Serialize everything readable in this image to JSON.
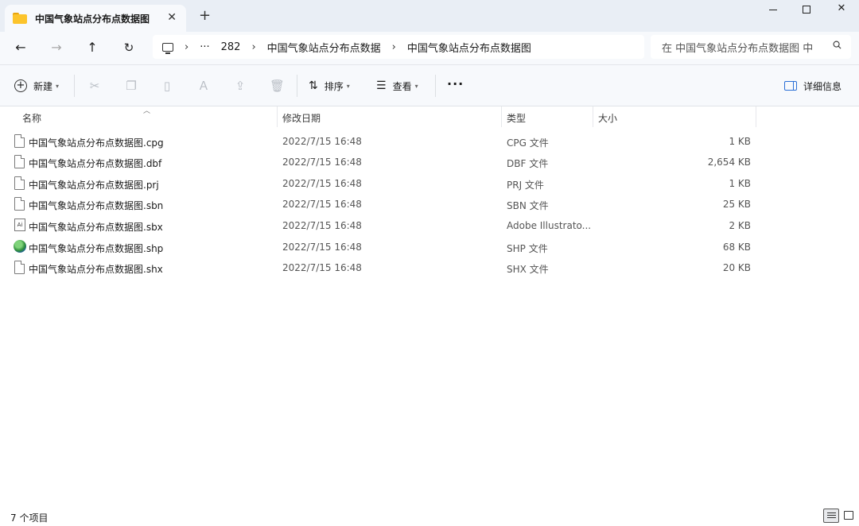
{
  "tab": {
    "title": "中国气象站点分布点数据图",
    "close": "✕",
    "new_tab": "+"
  },
  "window": {
    "minimize": "—",
    "maximize": "□",
    "close": "✕"
  },
  "nav": {
    "back": "←",
    "forward": "→",
    "up": "↑",
    "refresh": "↻"
  },
  "breadcrumb": {
    "more": "···",
    "sep": "›",
    "items": [
      "282",
      "中国气象站点分布点数据",
      "中国气象站点分布点数据图"
    ]
  },
  "search": {
    "placeholder": "在 中国气象站点分布点数据图 中"
  },
  "commands": {
    "new_label": "新建",
    "sort_label": "排序",
    "view_label": "查看",
    "more": "···",
    "details_label": "详细信息"
  },
  "columns": {
    "name": "名称",
    "date": "修改日期",
    "type": "类型",
    "size": "大小"
  },
  "files": [
    {
      "name": "中国气象站点分布点数据图.cpg",
      "date": "2022/7/15 16:48",
      "type": "CPG 文件",
      "size": "1 KB",
      "icon": "file-icon"
    },
    {
      "name": "中国气象站点分布点数据图.dbf",
      "date": "2022/7/15 16:48",
      "type": "DBF 文件",
      "size": "2,654 KB",
      "icon": "file-icon"
    },
    {
      "name": "中国气象站点分布点数据图.prj",
      "date": "2022/7/15 16:48",
      "type": "PRJ 文件",
      "size": "1 KB",
      "icon": "file-icon"
    },
    {
      "name": "中国气象站点分布点数据图.sbn",
      "date": "2022/7/15 16:48",
      "type": "SBN 文件",
      "size": "25 KB",
      "icon": "file-icon"
    },
    {
      "name": "中国气象站点分布点数据图.sbx",
      "date": "2022/7/15 16:48",
      "type": "Adobe Illustrato...",
      "size": "2 KB",
      "icon": "illustrator-file-icon"
    },
    {
      "name": "中国气象站点分布点数据图.shp",
      "date": "2022/7/15 16:48",
      "type": "SHP 文件",
      "size": "68 KB",
      "icon": "globe-file-icon"
    },
    {
      "name": "中国气象站点分布点数据图.shx",
      "date": "2022/7/15 16:48",
      "type": "SHX 文件",
      "size": "20 KB",
      "icon": "file-icon"
    }
  ],
  "status": {
    "count": "7 个项目"
  }
}
